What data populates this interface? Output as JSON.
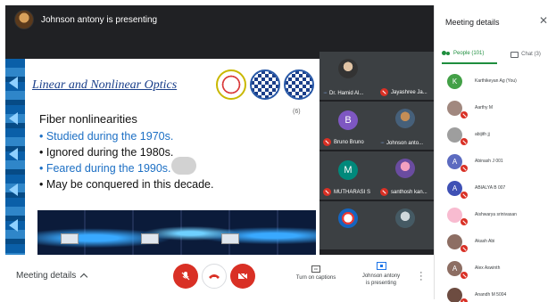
{
  "presenter_banner": "Johnson antony is presenting",
  "slide": {
    "title": "Linear and Nonlinear Optics",
    "page_number": "(6)",
    "subtitle": "Fiber nonlinearities",
    "bullets": [
      {
        "text": "• Studied during the 1970s.",
        "color": "blue"
      },
      {
        "text": "• Ignored during the 1980s.",
        "color": "black"
      },
      {
        "text": "• Feared during the 1990s.",
        "color": "blue"
      },
      {
        "text": "• May be conquered in this decade.",
        "color": "black"
      }
    ]
  },
  "tiles": [
    {
      "label": "Dr. Hamid Al...",
      "type": "photo",
      "status": "speaking"
    },
    {
      "label": "Jayashree Ja...",
      "type": "blank",
      "status": "muted"
    },
    {
      "label": "Bruno Bruno",
      "type": "letter",
      "letter": "B",
      "color": "#7e57c2",
      "status": "muted"
    },
    {
      "label": "Johnson anto...",
      "type": "photo",
      "status": "speaking"
    },
    {
      "label": "MUTHARASI S",
      "type": "letter",
      "letter": "M",
      "color": "#00897b",
      "status": "muted"
    },
    {
      "label": "santhosh kan...",
      "type": "photo",
      "status": "muted"
    },
    {
      "label": "",
      "type": "photo",
      "status": ""
    },
    {
      "label": "",
      "type": "photo",
      "status": ""
    }
  ],
  "controls": {
    "meeting_details": "Meeting details",
    "captions": "Turn on captions",
    "presenting_line1": "Johnson antony",
    "presenting_line2": "is presenting",
    "accent_red": "#d93025"
  },
  "panel": {
    "title": "Meeting details",
    "tab_people": "People (101)",
    "tab_chat": "Chat (3)",
    "accent_green": "#1e8e3e",
    "people": [
      {
        "name": "Karthikeyan Ag (You)",
        "letter": "K",
        "color": "#43a047",
        "muted": false
      },
      {
        "name": "Aarthy M",
        "letter": "",
        "color": "#a1887f",
        "muted": true
      },
      {
        "name": "abijith jj",
        "letter": "",
        "color": "#9e9e9e",
        "muted": true
      },
      {
        "name": "Abinash J 001",
        "letter": "A",
        "color": "#5c6bc0",
        "muted": true
      },
      {
        "name": "ABIALYA B 007",
        "letter": "A",
        "color": "#3f51b5",
        "muted": true
      },
      {
        "name": "Aishwarya srinivasan",
        "letter": "",
        "color": "#f8bbd0",
        "muted": true
      },
      {
        "name": "Akash Abi",
        "letter": "",
        "color": "#8d6e63",
        "muted": true
      },
      {
        "name": "Alex Aswinth",
        "letter": "A",
        "color": "#8d6e63",
        "muted": true
      },
      {
        "name": "Anandh M 5004",
        "letter": "",
        "color": "#6d4c41",
        "muted": true
      }
    ]
  }
}
